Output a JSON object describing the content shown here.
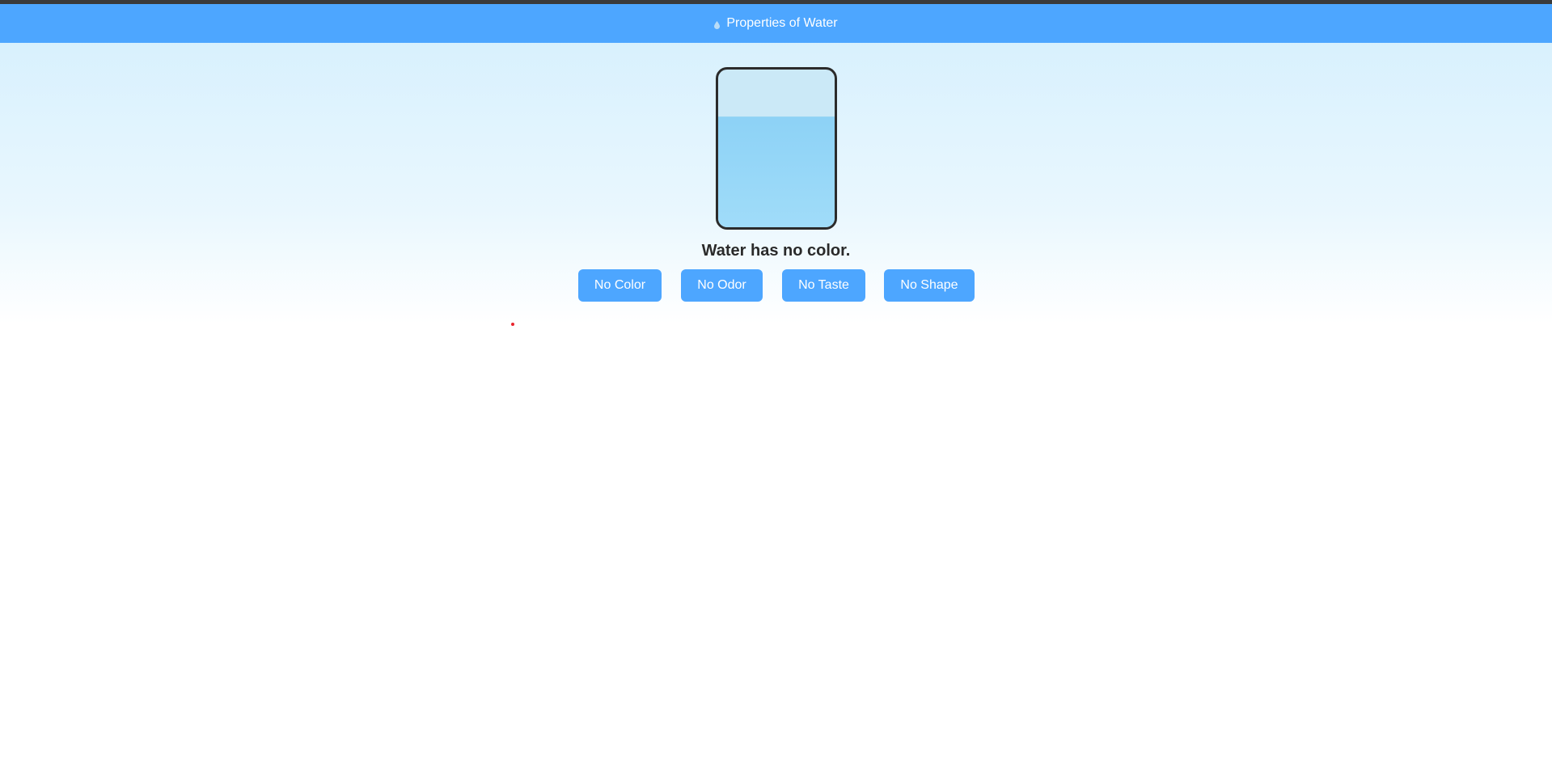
{
  "header": {
    "title": "Properties of Water",
    "icon": "water-drop-icon",
    "background": "#4da6ff"
  },
  "glass": {
    "water_fill_fraction": 0.7,
    "water_color": "#8dd2f6",
    "empty_color": "#cbe9f7"
  },
  "caption": {
    "text": "Water has no color."
  },
  "buttons": {
    "no_color": "No Color",
    "no_odor": "No Odor",
    "no_taste": "No Taste",
    "no_shape": "No Shape"
  },
  "colors": {
    "accent": "#4da6ff",
    "text": "#2a2a2a",
    "marker": "#e8242c"
  }
}
